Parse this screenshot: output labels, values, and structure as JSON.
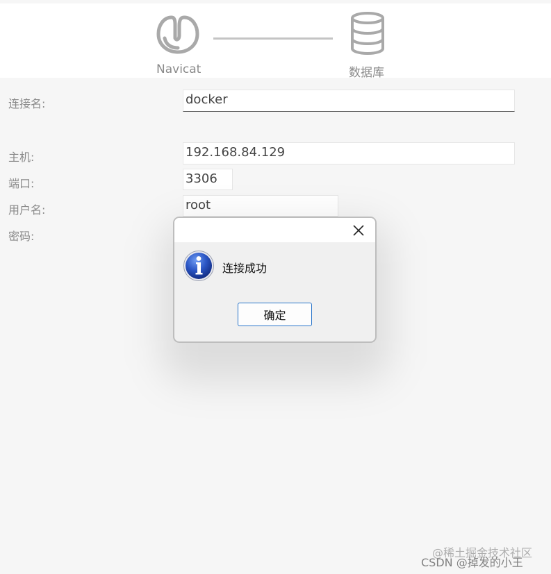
{
  "flow": {
    "source_label": "Navicat",
    "target_label": "数据库",
    "source_icon": "navicat-logo-icon",
    "target_icon": "database-icon"
  },
  "form": {
    "connection_name_label": "连接名:",
    "connection_name_value": "docker",
    "host_label": "主机:",
    "host_value": "192.168.84.129",
    "port_label": "端口:",
    "port_value": "3306",
    "username_label": "用户名:",
    "username_value": "root",
    "password_label": "密码:"
  },
  "dialog": {
    "message": "连接成功",
    "ok_label": "确定",
    "icon": "info-icon",
    "close_icon": "close-icon"
  },
  "watermark": {
    "line1": "@稀土掘金技术社区",
    "line2": "CSDN @掉发的小王"
  },
  "colors": {
    "background": "#f6f6f6",
    "button_border": "#2673c9",
    "info_blue": "#1d46b4"
  }
}
